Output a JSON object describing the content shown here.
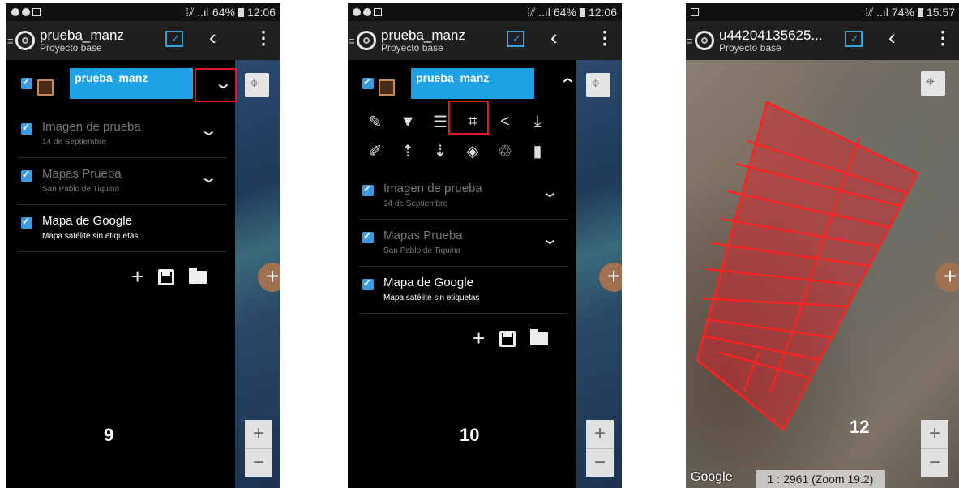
{
  "status_bars": [
    {
      "signal": "⁞⫽ ..ıl",
      "battery": "64%",
      "time": "12:06"
    },
    {
      "signal": "⁞⫽ ..ıl",
      "battery": "64%",
      "time": "12:06"
    },
    {
      "signal": "⁞⫽ ..ıl",
      "battery": "74%",
      "time": "15:57"
    }
  ],
  "screens": [
    {
      "title": "prueba_manz",
      "subtitle": "Proyecto base",
      "active_layer": "prueba_manz",
      "layers": [
        {
          "name": "Imagen de prueba",
          "sub": "14 de Septiembre"
        },
        {
          "name": "Mapas Prueba",
          "sub": "San Pablo de Tiquina"
        },
        {
          "name": "Mapa de Google",
          "sub": "Mapa satélite sin etiquetas"
        }
      ],
      "step": "9"
    },
    {
      "title": "prueba_manz",
      "subtitle": "Proyecto base",
      "active_layer": "prueba_manz",
      "layers": [
        {
          "name": "Imagen de prueba",
          "sub": "14 de Septiembre"
        },
        {
          "name": "Mapas Prueba",
          "sub": "San Pablo de Tiquina"
        },
        {
          "name": "Mapa de Google",
          "sub": "Mapa satélite sin etiquetas"
        }
      ],
      "step": "10"
    },
    {
      "title": "u44204135625...",
      "subtitle": "Proyecto base",
      "scale": "1 : 2961 (Zoom 19.2)",
      "attribution": "Google",
      "step": "12"
    }
  ],
  "glyphs": {
    "back": "‹",
    "menu": "⋮",
    "chevron_down": "⌄",
    "chevron_up": "⌃",
    "plus": "+",
    "minus": "−"
  },
  "colors": {
    "accent": "#1ea2e6",
    "highlight": "#e01a1a",
    "polygon": "#ff2020",
    "fab": "#a07050"
  },
  "icons": {
    "row1": [
      "pencil-edit-icon",
      "filter-icon",
      "table-icon",
      "crop-icon",
      "share-icon",
      "download-icon"
    ],
    "row2": [
      "brush-icon",
      "move-up-icon",
      "move-down-icon",
      "eraser-icon",
      "recycle-icon",
      "trash-icon"
    ]
  }
}
